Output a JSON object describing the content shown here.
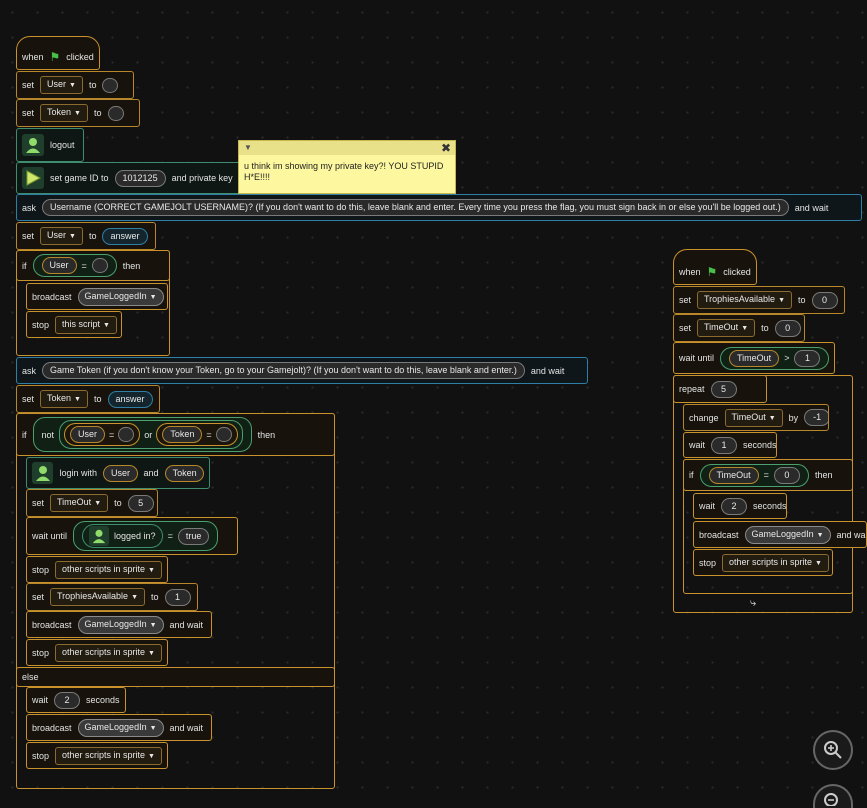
{
  "colors": {
    "background": "#111111",
    "control": "#c9922c",
    "variables": "#b8862b",
    "sensing": "#2e7fa6",
    "extension": "#3f8d6f",
    "note": "#fdf8a0"
  },
  "kw": {
    "when": "when",
    "clicked": "clicked",
    "set": "set",
    "to": "to",
    "ask": "ask",
    "and_wait": "and wait",
    "if": "if",
    "then": "then",
    "else": "else",
    "broadcast": "broadcast",
    "stop": "stop",
    "not": "not",
    "or": "or",
    "and": "and",
    "eq": "=",
    "gt": ">",
    "wait_until": "wait until",
    "wait": "wait",
    "seconds": "seconds",
    "repeat": "repeat",
    "change": "change",
    "by": "by",
    "login_with": "login with",
    "logged_in": "logged in?",
    "logout": "logout",
    "set_game_id": "set game ID to",
    "private_key": "and private key"
  },
  "vars": {
    "user": "User",
    "token": "Token",
    "answer": "answer",
    "timeout": "TimeOut",
    "trophies": "TrophiesAvailable",
    "msg": "GameLoggedIn",
    "true": "true",
    "this_script": "this script",
    "other_scripts": "other scripts in sprite"
  },
  "values": {
    "game_id": "1012125",
    "five": "5",
    "zero": "0",
    "one": "1",
    "two": "2",
    "minus_one": "-1"
  },
  "prompts": {
    "username": "Username (CORRECT GAMEJOLT USERNAME)? (If you don't want to do this, leave blank and enter. Every time you press the flag, you must sign back in or else you'll be logged out.)",
    "token": "Game Token (if you don't know your Token, go to your Gamejolt)? (If you don't want to do this, leave blank and enter.)"
  },
  "note": {
    "text": "u think im showing my private key?! YOU STUPID H*E!!!!"
  },
  "icons": {
    "flag": "green-flag-icon",
    "avatar": "gamejolt-avatar-icon",
    "zoom_in": "zoom-in-icon",
    "zoom_out": "zoom-out-icon",
    "loop": "loop-arrow-icon"
  }
}
